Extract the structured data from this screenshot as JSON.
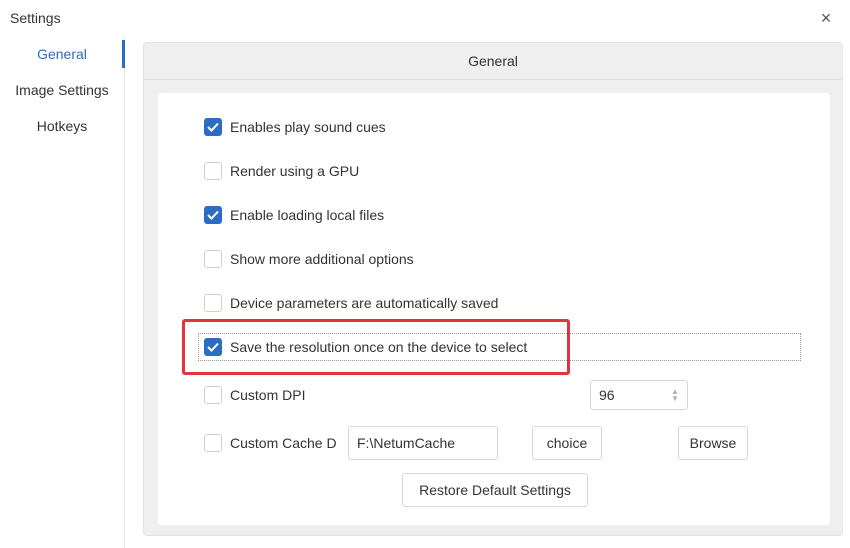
{
  "window": {
    "title": "Settings",
    "close_icon": "×"
  },
  "sidebar": {
    "items": [
      {
        "label": "General",
        "active": true
      },
      {
        "label": "Image Settings",
        "active": false
      },
      {
        "label": "Hotkeys",
        "active": false
      }
    ]
  },
  "panel": {
    "header": "General",
    "options": [
      {
        "label": "Enables play sound cues",
        "checked": true
      },
      {
        "label": "Render using a GPU",
        "checked": false
      },
      {
        "label": "Enable loading local files",
        "checked": true
      },
      {
        "label": "Show more additional options",
        "checked": false
      },
      {
        "label": "Device parameters are automatically saved",
        "checked": false
      },
      {
        "label": "Save the resolution once on the device to select",
        "checked": true
      }
    ],
    "custom_dpi": {
      "label": "Custom DPI",
      "checked": false,
      "value": "96"
    },
    "custom_cache": {
      "label": "Custom Cache D",
      "checked": false,
      "value": "F:\\NetumCache",
      "choice_label": "choice",
      "browse_label": "Browse"
    },
    "restore_label": "Restore Default Settings"
  },
  "colors": {
    "accent": "#2b6cc4",
    "highlight": "#e0343f",
    "panel_bg": "#efefef"
  }
}
